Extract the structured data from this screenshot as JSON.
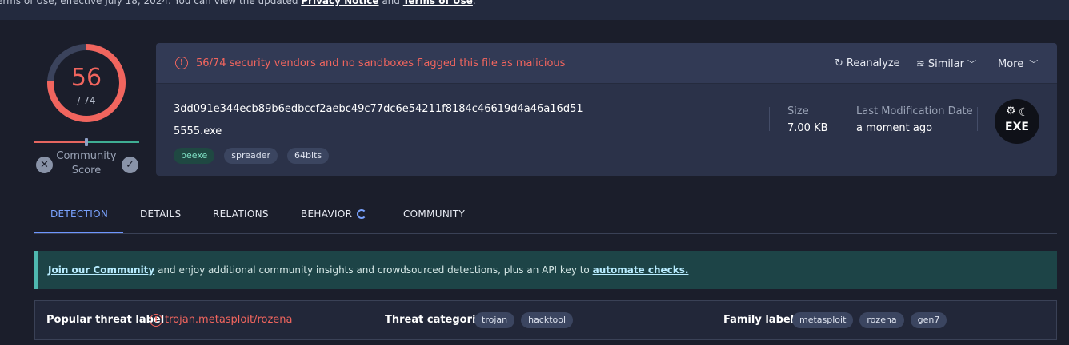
{
  "topbar": {
    "text_before": "erms of Use, effective July 18, 2024. You can view the updated ",
    "privacy_link": "Privacy Notice",
    "and_text": " and ",
    "terms_link": "Terms of Use",
    "text_after": "."
  },
  "score": {
    "detected": "56",
    "total": "/ 74",
    "fraction": 0.757,
    "community_label_1": "Community",
    "community_label_2": "Score"
  },
  "file": {
    "alert": "56/74 security vendors and no sandboxes flagged this file as malicious",
    "hash": "3dd091e344ecb89b6edbccf2aebc49c77dc6e54211f8184c46619d4a46a16d51",
    "name": "5555.exe",
    "tags": [
      "peexe",
      "spreader",
      "64bits"
    ],
    "size_label": "Size",
    "size_value": "7.00 KB",
    "modified_label": "Last Modification Date",
    "modified_value": "a moment ago",
    "type_icon_label": "EXE"
  },
  "actions": {
    "reanalyze": "Reanalyze",
    "similar": "Similar",
    "more": "More"
  },
  "tabs": [
    "DETECTION",
    "DETAILS",
    "RELATIONS",
    "BEHAVIOR",
    "COMMUNITY"
  ],
  "banner": {
    "join_link": "Join our Community",
    "text_mid": " and enjoy additional community insights and crowdsourced detections, plus an API key to ",
    "automate_link": "automate checks."
  },
  "threat": {
    "popular_label": "Popular threat label",
    "popular_value": "trojan.metasploit/rozena",
    "categories_label": "Threat categories",
    "categories": [
      "trojan",
      "hacktool"
    ],
    "family_label": "Family labels",
    "families": [
      "metasploit",
      "rozena",
      "gen7"
    ]
  },
  "colors": {
    "malicious": "#f1655e",
    "accent": "#7aa3ff",
    "background": "#1b1e2b"
  }
}
